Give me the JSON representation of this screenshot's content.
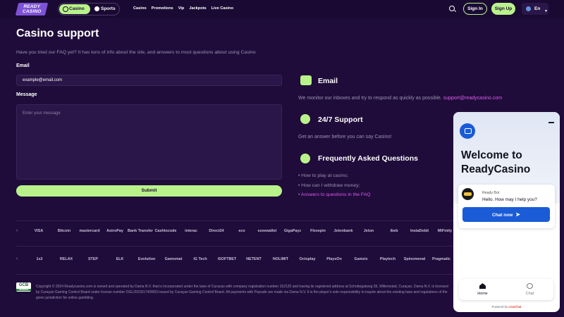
{
  "header": {
    "logo_text": "READY CASINO",
    "toggle": {
      "casino": "Casino",
      "sports": "Sports"
    },
    "nav": [
      "Casino",
      "Promotions",
      "Vip",
      "Jackpots",
      "Live Casino"
    ],
    "sign_in": "Sign In",
    "sign_up": "Sign Up",
    "language": "En"
  },
  "main": {
    "title": "Casino support",
    "intro": "Have you tried our FAQ yet? It has tons of info about the site, and answers to most questions about using Casino",
    "email_label": "Email",
    "email_value": "example@email.com",
    "message_label": "Message",
    "message_placeholder": "Enter your message",
    "submit": "Submit"
  },
  "info": {
    "email_heading": "Email",
    "email_text": "We monitor our inboxes and try to respond as quickly as possible.",
    "email_link": "support@readycasino.com",
    "support_heading": "24/7 Support",
    "support_text": "Get an answer before you can say Casino!",
    "faq_heading": "Frequently Asked Questions",
    "faq_items": [
      "How to play at casino;",
      "How can I withdraw money;"
    ],
    "faq_link": "Answers to questions in the FAQ"
  },
  "payments": [
    "VISA",
    "Bitcoin",
    "mastercard",
    "AstroPay",
    "Bank Transfer",
    "Cashtocode",
    "interac",
    "Direct24",
    "eco",
    "ezeewallet",
    "GigaPayz",
    "Flexepin",
    "Jetonbank",
    "Jeton",
    "ibeb",
    "InstaDebit",
    "MiFinity"
  ],
  "providers": [
    "1x2",
    "RELAX",
    "STEP",
    "ELK",
    "Evolution",
    "Gamomat",
    "iG Tech",
    "iSOFTBET",
    "NETENT",
    "NOLIMIT",
    "Octoplay",
    "PlaysOn",
    "Gamzix",
    "Playtech",
    "Spinomenal",
    "Pragmatic"
  ],
  "footer": {
    "badge": "GCB",
    "badge_sub": "VERIFIED",
    "copyright": "Copyright © 2024 Readycasino.com is owned and operated by Dama N.V. that is incorporated under the laws of Curacao with company registration number 152125 and having its registered address at Schottegatweg 39, Willemstad, Curaçao. Dama N.V. is licensed by Curaçao Gaming Control Board under license number OGL/2023/174/0063 issued by Curaçao Gaming Control Board. All payments with Paysafe are made via Dama N.V. It is the player's sole responsibility to inquire about the existing laws and regulations of the given jurisdiction for online gambling."
  },
  "chat": {
    "welcome": "Welcome to ReadyCasino",
    "bot_name": "Ready Bot",
    "bot_message": "Hello. How may I help you?",
    "chat_now": "Chat now",
    "tab_home": "Home",
    "tab_chat": "Chat",
    "powered_prefix": "Powered by",
    "powered_brand": "LiveChat"
  }
}
